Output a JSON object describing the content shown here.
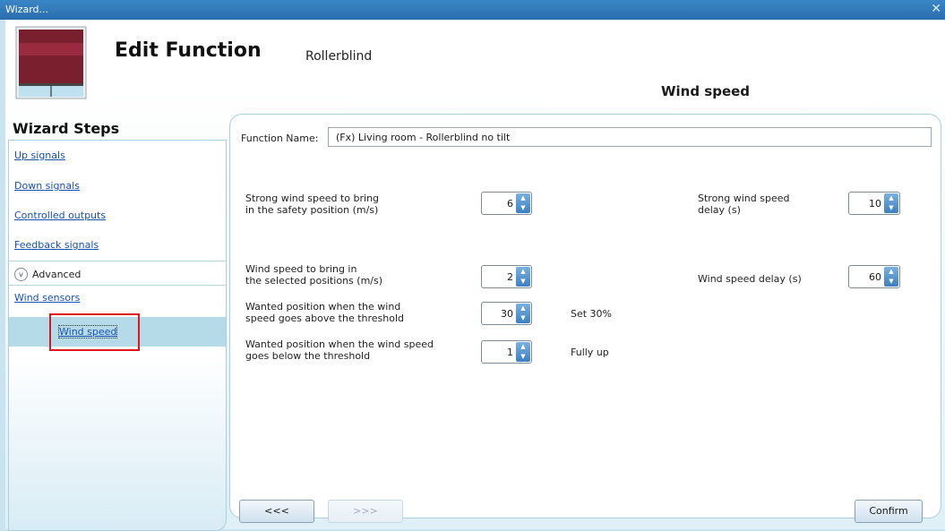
{
  "window": {
    "title": "Wizard...",
    "close_glyph": "✕"
  },
  "header": {
    "title": "Edit Function",
    "subtitle": "Rollerblind",
    "tab": "Wind speed"
  },
  "sidebar": {
    "title": "Wizard Steps",
    "steps": [
      {
        "label": "Up signals"
      },
      {
        "label": "Down signals"
      },
      {
        "label": "Controlled outputs"
      },
      {
        "label": "Feedback signals"
      }
    ],
    "advanced_label": "Advanced",
    "wind_sensors": "Wind sensors",
    "selected": "Wind speed"
  },
  "form": {
    "function_name_label": "Function Name:",
    "function_name_value": "(Fx) Living room - Rollerblind no tilt",
    "strong_wind_label_1": "Strong wind speed to bring",
    "strong_wind_label_2": "in the safety position (m/s)",
    "strong_wind_value": "6",
    "strong_delay_label_1": "Strong wind speed",
    "strong_delay_label_2": "delay (s)",
    "strong_delay_value": "10",
    "wind_speed_label_1": "Wind speed to bring in",
    "wind_speed_label_2": "the selected positions (m/s)",
    "wind_speed_value": "2",
    "wind_delay_label": "Wind speed delay (s)",
    "wind_delay_value": "60",
    "above_label_1": "Wanted position when the wind",
    "above_label_2": "speed goes above the threshold",
    "above_value": "30",
    "above_desc": "Set 30%",
    "below_label_1": "Wanted position when the wind speed",
    "below_label_2": "goes below the threshold",
    "below_value": "1",
    "below_desc": "Fully up"
  },
  "footer": {
    "back": "<<<",
    "next": ">>>",
    "confirm": "Confirm"
  },
  "colors": {
    "accent": "#2a6eaf",
    "highlight": "#e0141b",
    "link": "#1650b8"
  }
}
